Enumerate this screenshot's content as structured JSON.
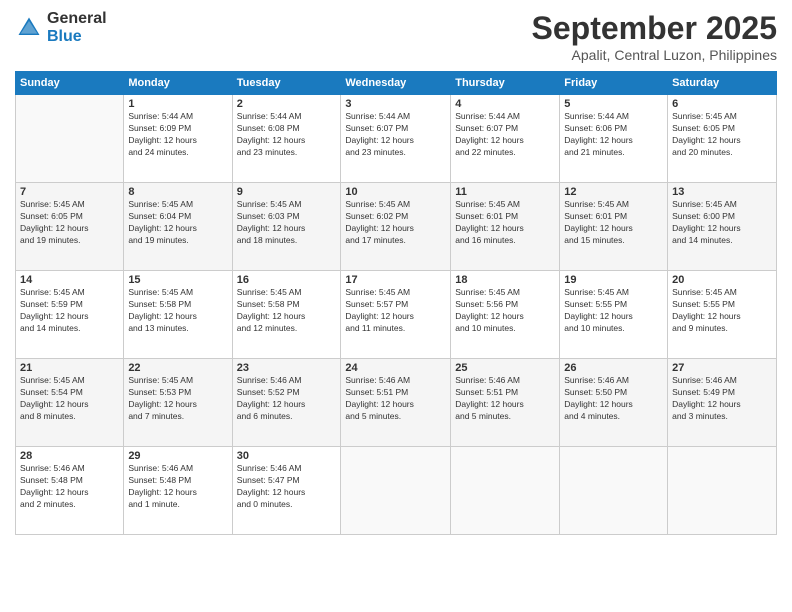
{
  "header": {
    "logo_line1": "General",
    "logo_line2": "Blue",
    "month": "September 2025",
    "location": "Apalit, Central Luzon, Philippines"
  },
  "weekdays": [
    "Sunday",
    "Monday",
    "Tuesday",
    "Wednesday",
    "Thursday",
    "Friday",
    "Saturday"
  ],
  "weeks": [
    [
      {
        "day": "",
        "info": ""
      },
      {
        "day": "1",
        "info": "Sunrise: 5:44 AM\nSunset: 6:09 PM\nDaylight: 12 hours\nand 24 minutes."
      },
      {
        "day": "2",
        "info": "Sunrise: 5:44 AM\nSunset: 6:08 PM\nDaylight: 12 hours\nand 23 minutes."
      },
      {
        "day": "3",
        "info": "Sunrise: 5:44 AM\nSunset: 6:07 PM\nDaylight: 12 hours\nand 23 minutes."
      },
      {
        "day": "4",
        "info": "Sunrise: 5:44 AM\nSunset: 6:07 PM\nDaylight: 12 hours\nand 22 minutes."
      },
      {
        "day": "5",
        "info": "Sunrise: 5:44 AM\nSunset: 6:06 PM\nDaylight: 12 hours\nand 21 minutes."
      },
      {
        "day": "6",
        "info": "Sunrise: 5:45 AM\nSunset: 6:05 PM\nDaylight: 12 hours\nand 20 minutes."
      }
    ],
    [
      {
        "day": "7",
        "info": "Sunrise: 5:45 AM\nSunset: 6:05 PM\nDaylight: 12 hours\nand 19 minutes."
      },
      {
        "day": "8",
        "info": "Sunrise: 5:45 AM\nSunset: 6:04 PM\nDaylight: 12 hours\nand 19 minutes."
      },
      {
        "day": "9",
        "info": "Sunrise: 5:45 AM\nSunset: 6:03 PM\nDaylight: 12 hours\nand 18 minutes."
      },
      {
        "day": "10",
        "info": "Sunrise: 5:45 AM\nSunset: 6:02 PM\nDaylight: 12 hours\nand 17 minutes."
      },
      {
        "day": "11",
        "info": "Sunrise: 5:45 AM\nSunset: 6:01 PM\nDaylight: 12 hours\nand 16 minutes."
      },
      {
        "day": "12",
        "info": "Sunrise: 5:45 AM\nSunset: 6:01 PM\nDaylight: 12 hours\nand 15 minutes."
      },
      {
        "day": "13",
        "info": "Sunrise: 5:45 AM\nSunset: 6:00 PM\nDaylight: 12 hours\nand 14 minutes."
      }
    ],
    [
      {
        "day": "14",
        "info": "Sunrise: 5:45 AM\nSunset: 5:59 PM\nDaylight: 12 hours\nand 14 minutes."
      },
      {
        "day": "15",
        "info": "Sunrise: 5:45 AM\nSunset: 5:58 PM\nDaylight: 12 hours\nand 13 minutes."
      },
      {
        "day": "16",
        "info": "Sunrise: 5:45 AM\nSunset: 5:58 PM\nDaylight: 12 hours\nand 12 minutes."
      },
      {
        "day": "17",
        "info": "Sunrise: 5:45 AM\nSunset: 5:57 PM\nDaylight: 12 hours\nand 11 minutes."
      },
      {
        "day": "18",
        "info": "Sunrise: 5:45 AM\nSunset: 5:56 PM\nDaylight: 12 hours\nand 10 minutes."
      },
      {
        "day": "19",
        "info": "Sunrise: 5:45 AM\nSunset: 5:55 PM\nDaylight: 12 hours\nand 10 minutes."
      },
      {
        "day": "20",
        "info": "Sunrise: 5:45 AM\nSunset: 5:55 PM\nDaylight: 12 hours\nand 9 minutes."
      }
    ],
    [
      {
        "day": "21",
        "info": "Sunrise: 5:45 AM\nSunset: 5:54 PM\nDaylight: 12 hours\nand 8 minutes."
      },
      {
        "day": "22",
        "info": "Sunrise: 5:45 AM\nSunset: 5:53 PM\nDaylight: 12 hours\nand 7 minutes."
      },
      {
        "day": "23",
        "info": "Sunrise: 5:46 AM\nSunset: 5:52 PM\nDaylight: 12 hours\nand 6 minutes."
      },
      {
        "day": "24",
        "info": "Sunrise: 5:46 AM\nSunset: 5:51 PM\nDaylight: 12 hours\nand 5 minutes."
      },
      {
        "day": "25",
        "info": "Sunrise: 5:46 AM\nSunset: 5:51 PM\nDaylight: 12 hours\nand 5 minutes."
      },
      {
        "day": "26",
        "info": "Sunrise: 5:46 AM\nSunset: 5:50 PM\nDaylight: 12 hours\nand 4 minutes."
      },
      {
        "day": "27",
        "info": "Sunrise: 5:46 AM\nSunset: 5:49 PM\nDaylight: 12 hours\nand 3 minutes."
      }
    ],
    [
      {
        "day": "28",
        "info": "Sunrise: 5:46 AM\nSunset: 5:48 PM\nDaylight: 12 hours\nand 2 minutes."
      },
      {
        "day": "29",
        "info": "Sunrise: 5:46 AM\nSunset: 5:48 PM\nDaylight: 12 hours\nand 1 minute."
      },
      {
        "day": "30",
        "info": "Sunrise: 5:46 AM\nSunset: 5:47 PM\nDaylight: 12 hours\nand 0 minutes."
      },
      {
        "day": "",
        "info": ""
      },
      {
        "day": "",
        "info": ""
      },
      {
        "day": "",
        "info": ""
      },
      {
        "day": "",
        "info": ""
      }
    ]
  ]
}
